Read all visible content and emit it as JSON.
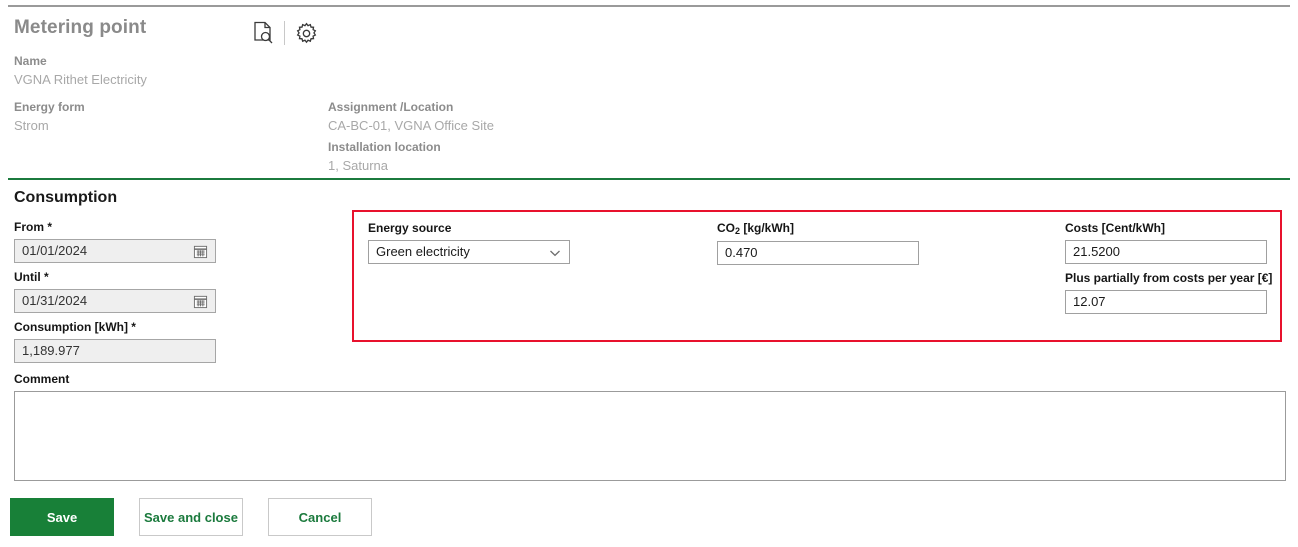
{
  "header": {
    "title": "Metering point",
    "icons": [
      {
        "name": "document-search-icon",
        "label": "Preview document"
      },
      {
        "name": "gear-icon",
        "label": "Settings"
      }
    ],
    "fields": [
      {
        "label": "Name",
        "value": "VGNA Rithet Electricity"
      },
      {
        "label": "Energy form",
        "value": "Strom"
      },
      {
        "label": "Assignment /Location",
        "value": "CA-BC-01, VGNA Office Site"
      },
      {
        "label": "Installation location",
        "value": "1, Saturna"
      }
    ]
  },
  "section": {
    "title": "Consumption"
  },
  "form": {
    "from": {
      "label": "From *",
      "value": "01/01/2024",
      "icon": "calendar-icon"
    },
    "until": {
      "label": "Until *",
      "value": "01/31/2024",
      "icon": "calendar-icon"
    },
    "consumption": {
      "label": "Consumption [kWh] *",
      "value": "1,189.977"
    },
    "comment": {
      "label": "Comment",
      "value": "",
      "placeholder": ""
    },
    "energy_source": {
      "label": "Energy source",
      "value": "Green electricity",
      "options": [
        "Green electricity"
      ],
      "icon": "chevron-down-icon"
    },
    "co2": {
      "label_prefix": "CO",
      "label_sub": "2",
      "label_suffix": " [kg/kWh]",
      "value": "0.470"
    },
    "costs": {
      "label": "Costs [Cent/kWh]",
      "value": "21.5200"
    },
    "plus_partially": {
      "label": "Plus partially from costs per year [€]",
      "value": "12.07"
    }
  },
  "buttons": {
    "save": "Save",
    "save_and_close": "Save and close",
    "cancel": "Cancel"
  },
  "colors": {
    "accent_green": "#188038",
    "divider_green": "#1b7a3d",
    "highlight_red": "#e8112d",
    "muted_gray": "#a8a8a8"
  }
}
